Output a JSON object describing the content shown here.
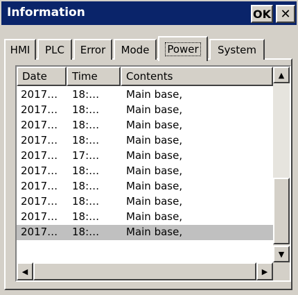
{
  "window": {
    "title": "Information",
    "ok_label": "OK",
    "close_label": "✕"
  },
  "tabs": [
    {
      "label": "HMI",
      "active": false
    },
    {
      "label": "PLC",
      "active": false
    },
    {
      "label": "Error",
      "active": false
    },
    {
      "label": "Mode",
      "active": false
    },
    {
      "label": "Power",
      "active": true
    },
    {
      "label": "System",
      "active": false
    }
  ],
  "table": {
    "columns": [
      "Date",
      "Time",
      "Contents"
    ],
    "rows": [
      [
        "2017…",
        "18:…",
        "Main base,"
      ],
      [
        "2017…",
        "18:…",
        "Main base,"
      ],
      [
        "2017…",
        "18:…",
        "Main base,"
      ],
      [
        "2017…",
        "18:…",
        "Main base,"
      ],
      [
        "2017…",
        "17:…",
        "Main base,"
      ],
      [
        "2017…",
        "18:…",
        "Main base,"
      ],
      [
        "2017…",
        "18:…",
        "Main base,"
      ],
      [
        "2017…",
        "18:…",
        "Main base,"
      ],
      [
        "2017…",
        "18:…",
        "Main base,"
      ],
      [
        "2017…",
        "18:…",
        "Main base,"
      ]
    ],
    "selected_row": 9
  },
  "scroll": {
    "up_icon": "▲",
    "down_icon": "▼",
    "left_icon": "◀",
    "right_icon": "▶"
  }
}
